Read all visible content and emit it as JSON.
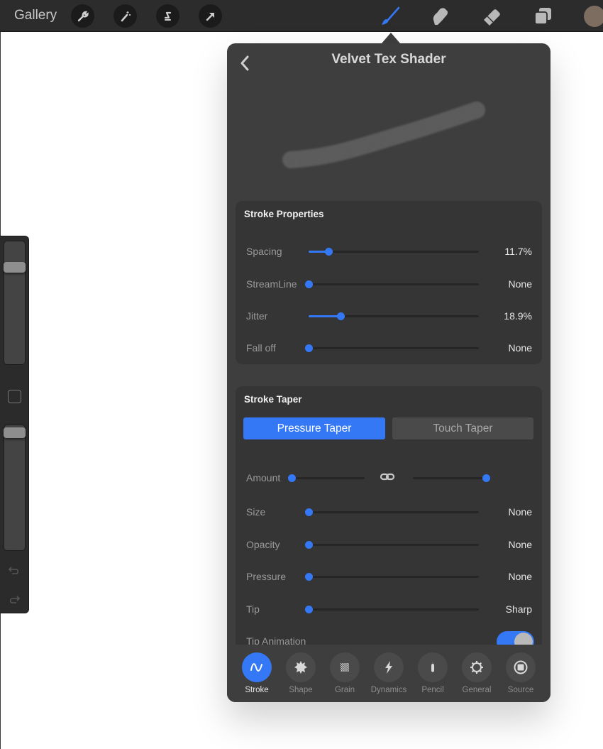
{
  "topbar": {
    "gallery_label": "Gallery",
    "left_tools": [
      {
        "name": "actions",
        "icon": "wrench-icon"
      },
      {
        "name": "adjustments",
        "icon": "magic-wand-icon"
      },
      {
        "name": "selection",
        "icon": "selection-s-icon"
      },
      {
        "name": "transform",
        "icon": "arrow-cursor-icon"
      }
    ],
    "right_tools": [
      {
        "name": "brush",
        "icon": "brush-icon",
        "active": true
      },
      {
        "name": "smudge",
        "icon": "smudge-finger-icon",
        "active": false
      },
      {
        "name": "eraser",
        "icon": "eraser-icon",
        "active": false
      },
      {
        "name": "layers",
        "icon": "layers-icon",
        "active": false
      }
    ],
    "current_color": "#7d6c60"
  },
  "sidebar": {
    "brush_size_value": 0.12,
    "opacity_value": 0.0,
    "modify_button": "square-modify-icon",
    "undo": "undo-icon",
    "redo": "redo-icon"
  },
  "panel": {
    "title": "Velvet Tex Shader",
    "back_icon": "chevron-left-icon",
    "stroke_properties": {
      "title": "Stroke Properties",
      "rows": [
        {
          "label": "Spacing",
          "value": "11.7%",
          "fraction": 0.117
        },
        {
          "label": "StreamLine",
          "value": "None",
          "fraction": 0
        },
        {
          "label": "Jitter",
          "value": "18.9%",
          "fraction": 0.189
        },
        {
          "label": "Fall off",
          "value": "None",
          "fraction": 0
        }
      ]
    },
    "stroke_taper": {
      "title": "Stroke Taper",
      "segments": {
        "active": "Pressure Taper",
        "inactive": "Touch Taper"
      },
      "amount": {
        "label": "Amount",
        "left_fraction": 0,
        "right_fraction": 1.0,
        "link_icon": "link-icon"
      },
      "rows": [
        {
          "label": "Size",
          "value": "None",
          "fraction": 0
        },
        {
          "label": "Opacity",
          "value": "None",
          "fraction": 0
        },
        {
          "label": "Pressure",
          "value": "None",
          "fraction": 0
        },
        {
          "label": "Tip",
          "value": "Sharp",
          "fraction": 0
        }
      ],
      "tip_animation": {
        "label": "Tip Animation",
        "on": true
      }
    },
    "tabs": [
      {
        "label": "Stroke",
        "icon": "stroke-wave-icon",
        "active": true
      },
      {
        "label": "Shape",
        "icon": "shape-burst-icon",
        "active": false
      },
      {
        "label": "Grain",
        "icon": "grain-checker-icon",
        "active": false
      },
      {
        "label": "Dynamics",
        "icon": "lightning-icon",
        "active": false
      },
      {
        "label": "Pencil",
        "icon": "pencil-tip-icon",
        "active": false
      },
      {
        "label": "General",
        "icon": "gear-icon",
        "active": false
      },
      {
        "label": "Source",
        "icon": "source-square-icon",
        "active": false
      }
    ]
  },
  "colors": {
    "accent": "#3478f6",
    "panel_bg": "#3e3e3e",
    "card_bg": "#353535",
    "topbar_bg": "#2c2c2c"
  }
}
